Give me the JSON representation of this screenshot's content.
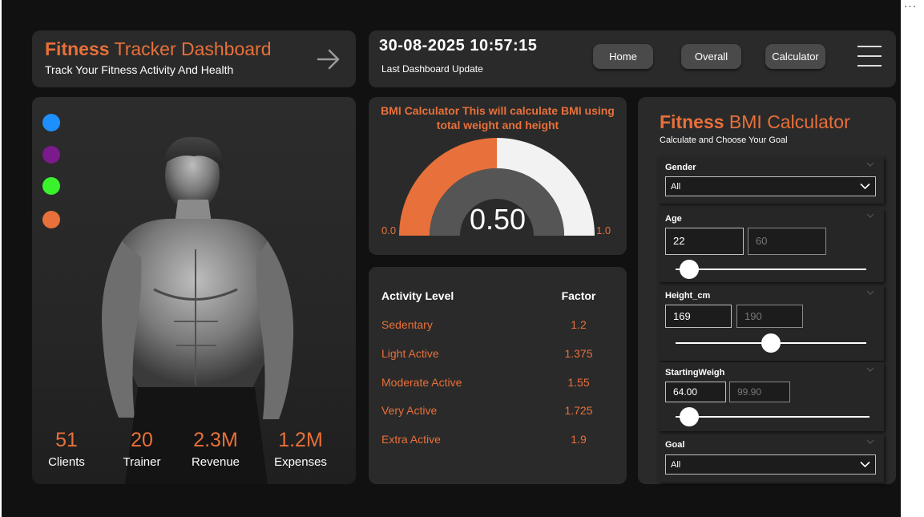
{
  "more_icon": "more-horizontal-icon",
  "title_card": {
    "brand": "Fitness",
    "title_rest": " Tracker Dashboard",
    "subtitle": "Track Your Fitness Activity And Health",
    "icon": "arrow-right-icon"
  },
  "header": {
    "datetime": "30-08-2025 10:57:15",
    "last_update_label": "Last Dashboard Update",
    "nav": [
      {
        "label": "Home"
      },
      {
        "label": "Overall"
      },
      {
        "label": "Calculator"
      }
    ],
    "menu_icon": "hamburger-menu-icon"
  },
  "image_card": {
    "legend_colors": [
      "#1e8fff",
      "#7a1a8c",
      "#39f22b",
      "#e8703a"
    ],
    "kpis": [
      {
        "value": "51",
        "label": "Clients"
      },
      {
        "value": "20",
        "label": "Trainer"
      },
      {
        "value": "2.3M",
        "label": "Revenue"
      },
      {
        "value": "1.2M",
        "label": "Expenses"
      }
    ]
  },
  "gauge": {
    "title": "BMI Calculator This will calculate BMI using total weight and height",
    "value_text": "0.50",
    "value": 0.5,
    "min_label": "0.0",
    "max_label": "1.0",
    "min": 0.0,
    "max": 1.0,
    "fill_color": "#e8703a",
    "rest_color": "#f2f2f2",
    "inner_color": "#555555"
  },
  "activity": {
    "headers": {
      "level": "Activity Level",
      "factor": "Factor"
    },
    "rows": [
      {
        "level": "Sedentary",
        "factor": "1.2"
      },
      {
        "level": "Light Active",
        "factor": "1.375"
      },
      {
        "level": "Moderate Active",
        "factor": "1.55"
      },
      {
        "level": "Very Active",
        "factor": "1.725"
      },
      {
        "level": "Extra Active",
        "factor": "1.9"
      }
    ]
  },
  "calculator": {
    "brand": "Fitness",
    "title_rest": " BMI Calculator",
    "subtitle": "Calculate and Choose Your Goal",
    "gender": {
      "label": "Gender",
      "selected": "All"
    },
    "age": {
      "label": "Age",
      "min_value": "22",
      "max_value": "60",
      "level": 0
    },
    "height": {
      "label": "Height_cm",
      "min_value": "169",
      "max_value": "190",
      "level": 0.5
    },
    "weight": {
      "label": "StartingWeigh",
      "min_value": "64.00",
      "max_value": "99.90",
      "level": 0
    },
    "goal": {
      "label": "Goal",
      "selected": "All"
    }
  }
}
